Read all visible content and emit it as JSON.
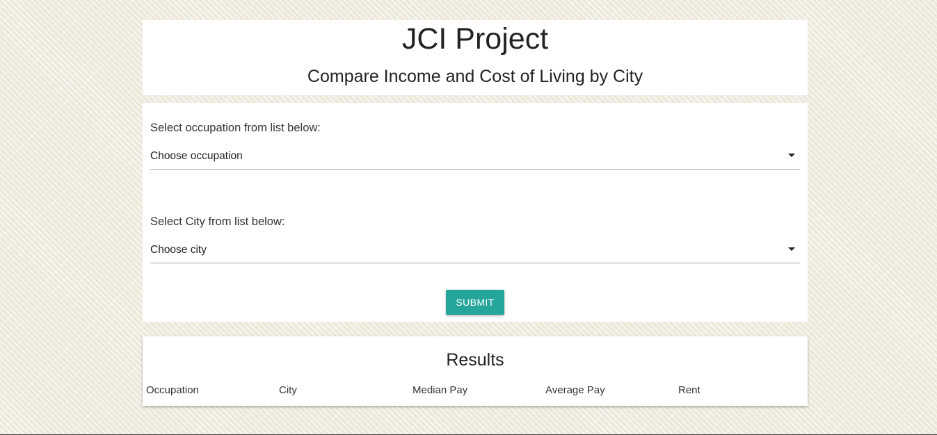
{
  "header": {
    "title": "JCI Project",
    "subtitle": "Compare Income and Cost of Living by City"
  },
  "form": {
    "occupation_label": "Select occupation from list below:",
    "occupation_selected": "Choose occupation",
    "city_label": "Select City from list below:",
    "city_selected": "Choose city",
    "submit_label": "SUBMIT"
  },
  "results": {
    "title": "Results",
    "columns": [
      "Occupation",
      "City",
      "Median Pay",
      "Average Pay",
      "Rent"
    ]
  },
  "colors": {
    "accent": "#26a69a",
    "background": "#ece8da",
    "card": "#ffffff"
  },
  "icons": {
    "select_caret": "caret-down-icon"
  }
}
